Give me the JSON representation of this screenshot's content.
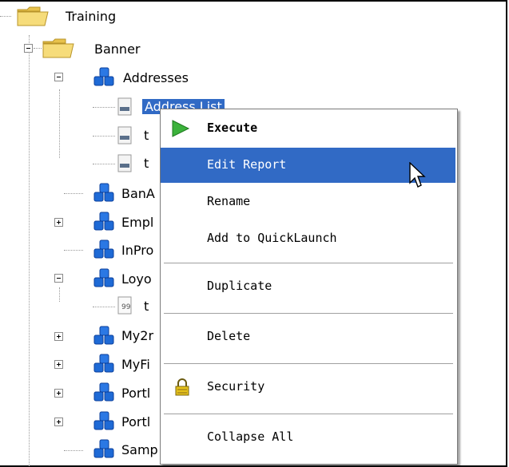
{
  "tree": {
    "root_label": "Training",
    "banner_label": "Banner",
    "addresses_label": "Addresses",
    "address_list_label": "Address List",
    "child_b_label": "t",
    "child_c_label": "t",
    "banadmin_label": "BanA",
    "empl_label": "Empl",
    "inpro_label": "InPro",
    "loyo_label": "Loyo",
    "loyo_child_label": "t",
    "my2_label": "My2r",
    "myfi_label": "MyFi",
    "portl1_label": "Portl",
    "portl2_label": "Portl",
    "samp_label": "Samp"
  },
  "menu": {
    "execute": "Execute",
    "edit_report": "Edit Report",
    "rename": "Rename",
    "add_quicklaunch": "Add to QuickLaunch",
    "duplicate": "Duplicate",
    "delete": "Delete",
    "security": "Security",
    "collapse_all": "Collapse All"
  },
  "icons": {
    "folder": "folder-icon",
    "report_group": "blocks-icon",
    "report": "report-icon",
    "execute": "play-icon",
    "security": "lock-icon",
    "cursor": "arrow-cursor-icon"
  },
  "colors": {
    "selection": "#316ac5",
    "folder": "#f3d36b",
    "blocks": "#1e6ad6",
    "play": "#3bb23b",
    "lock": "#e5c21b"
  }
}
